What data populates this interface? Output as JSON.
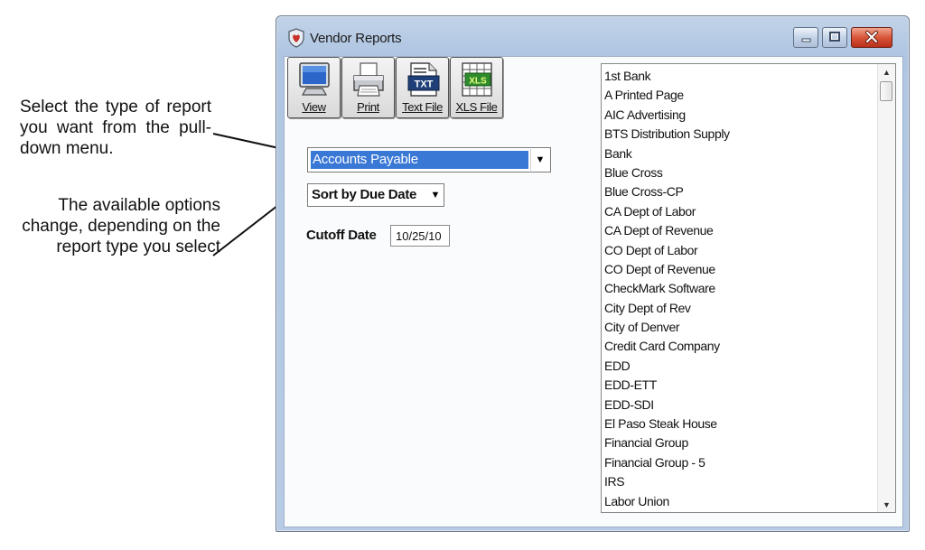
{
  "annotations": {
    "note1": "Select the type of report you want from the pull-down menu.",
    "note2": "The available options change, depending on the report type you select"
  },
  "window": {
    "title": "Vendor Reports",
    "icon": "shield-heart-icon"
  },
  "toolbar": {
    "view_label": "View",
    "print_label": "Print",
    "txt_label": "Text File",
    "xls_label": "XLS File",
    "txt_badge": "TXT",
    "xls_badge": "XLS"
  },
  "report_type": {
    "selected": "Accounts Payable"
  },
  "sort_option": {
    "selected": "Sort by Due Date"
  },
  "cutoff": {
    "label": "Cutoff Date",
    "value": "10/25/10"
  },
  "vendors": [
    "1st Bank",
    "A Printed Page",
    "AIC Advertising",
    "BTS Distribution Supply",
    "Bank",
    "Blue Cross",
    "Blue Cross-CP",
    "CA Dept of Labor",
    "CA Dept of Revenue",
    "CO Dept of Labor",
    "CO Dept of Revenue",
    "CheckMark Software",
    "City Dept of Rev",
    "City of Denver",
    "Credit Card Company",
    "EDD",
    "EDD-ETT",
    "EDD-SDI",
    "El Paso Steak House",
    "Financial Group",
    "Financial Group - 5",
    "IRS",
    "Labor Union"
  ],
  "colors": {
    "selection": "#3a78d6",
    "close_button": "#d8553a",
    "title_bar": "#b7cbe5"
  }
}
